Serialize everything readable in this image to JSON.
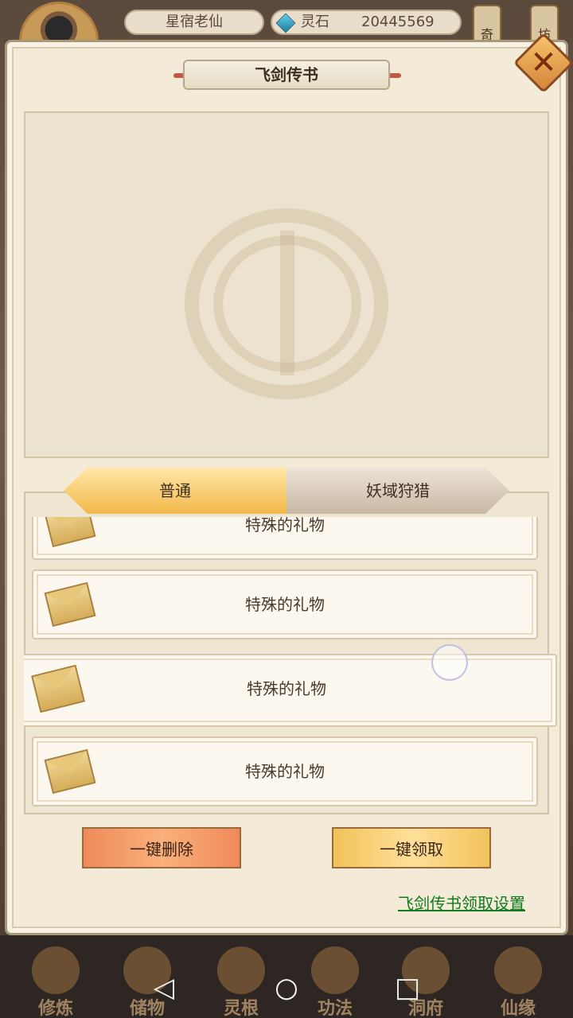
{
  "top_bar": {
    "player_name": "星宿老仙",
    "stone_label": "灵石",
    "stone_value": "20445569",
    "tabs": [
      "奇",
      "坊"
    ]
  },
  "dialog": {
    "title": "飞剑传书",
    "tabs": [
      {
        "label": "普通",
        "active": true
      },
      {
        "label": "妖域狩猎",
        "active": false
      }
    ],
    "mails": [
      {
        "title": "特殊的礼物"
      },
      {
        "title": "特殊的礼物"
      },
      {
        "title": "特殊的礼物"
      },
      {
        "title": "特殊的礼物"
      }
    ],
    "delete_all_label": "一键删除",
    "claim_all_label": "一键领取",
    "settings_link": "飞剑传书领取设置"
  },
  "bottom_nav": {
    "items": [
      "修炼",
      "储物",
      "灵根",
      "功法",
      "洞府",
      "仙缘"
    ]
  },
  "system_nav": {
    "back": "◁",
    "home": "○",
    "recents": "□"
  },
  "colors": {
    "panel_bg": "#f3ead7",
    "active_tab": "#f2b84a",
    "link_green": "#0f7a1e"
  }
}
